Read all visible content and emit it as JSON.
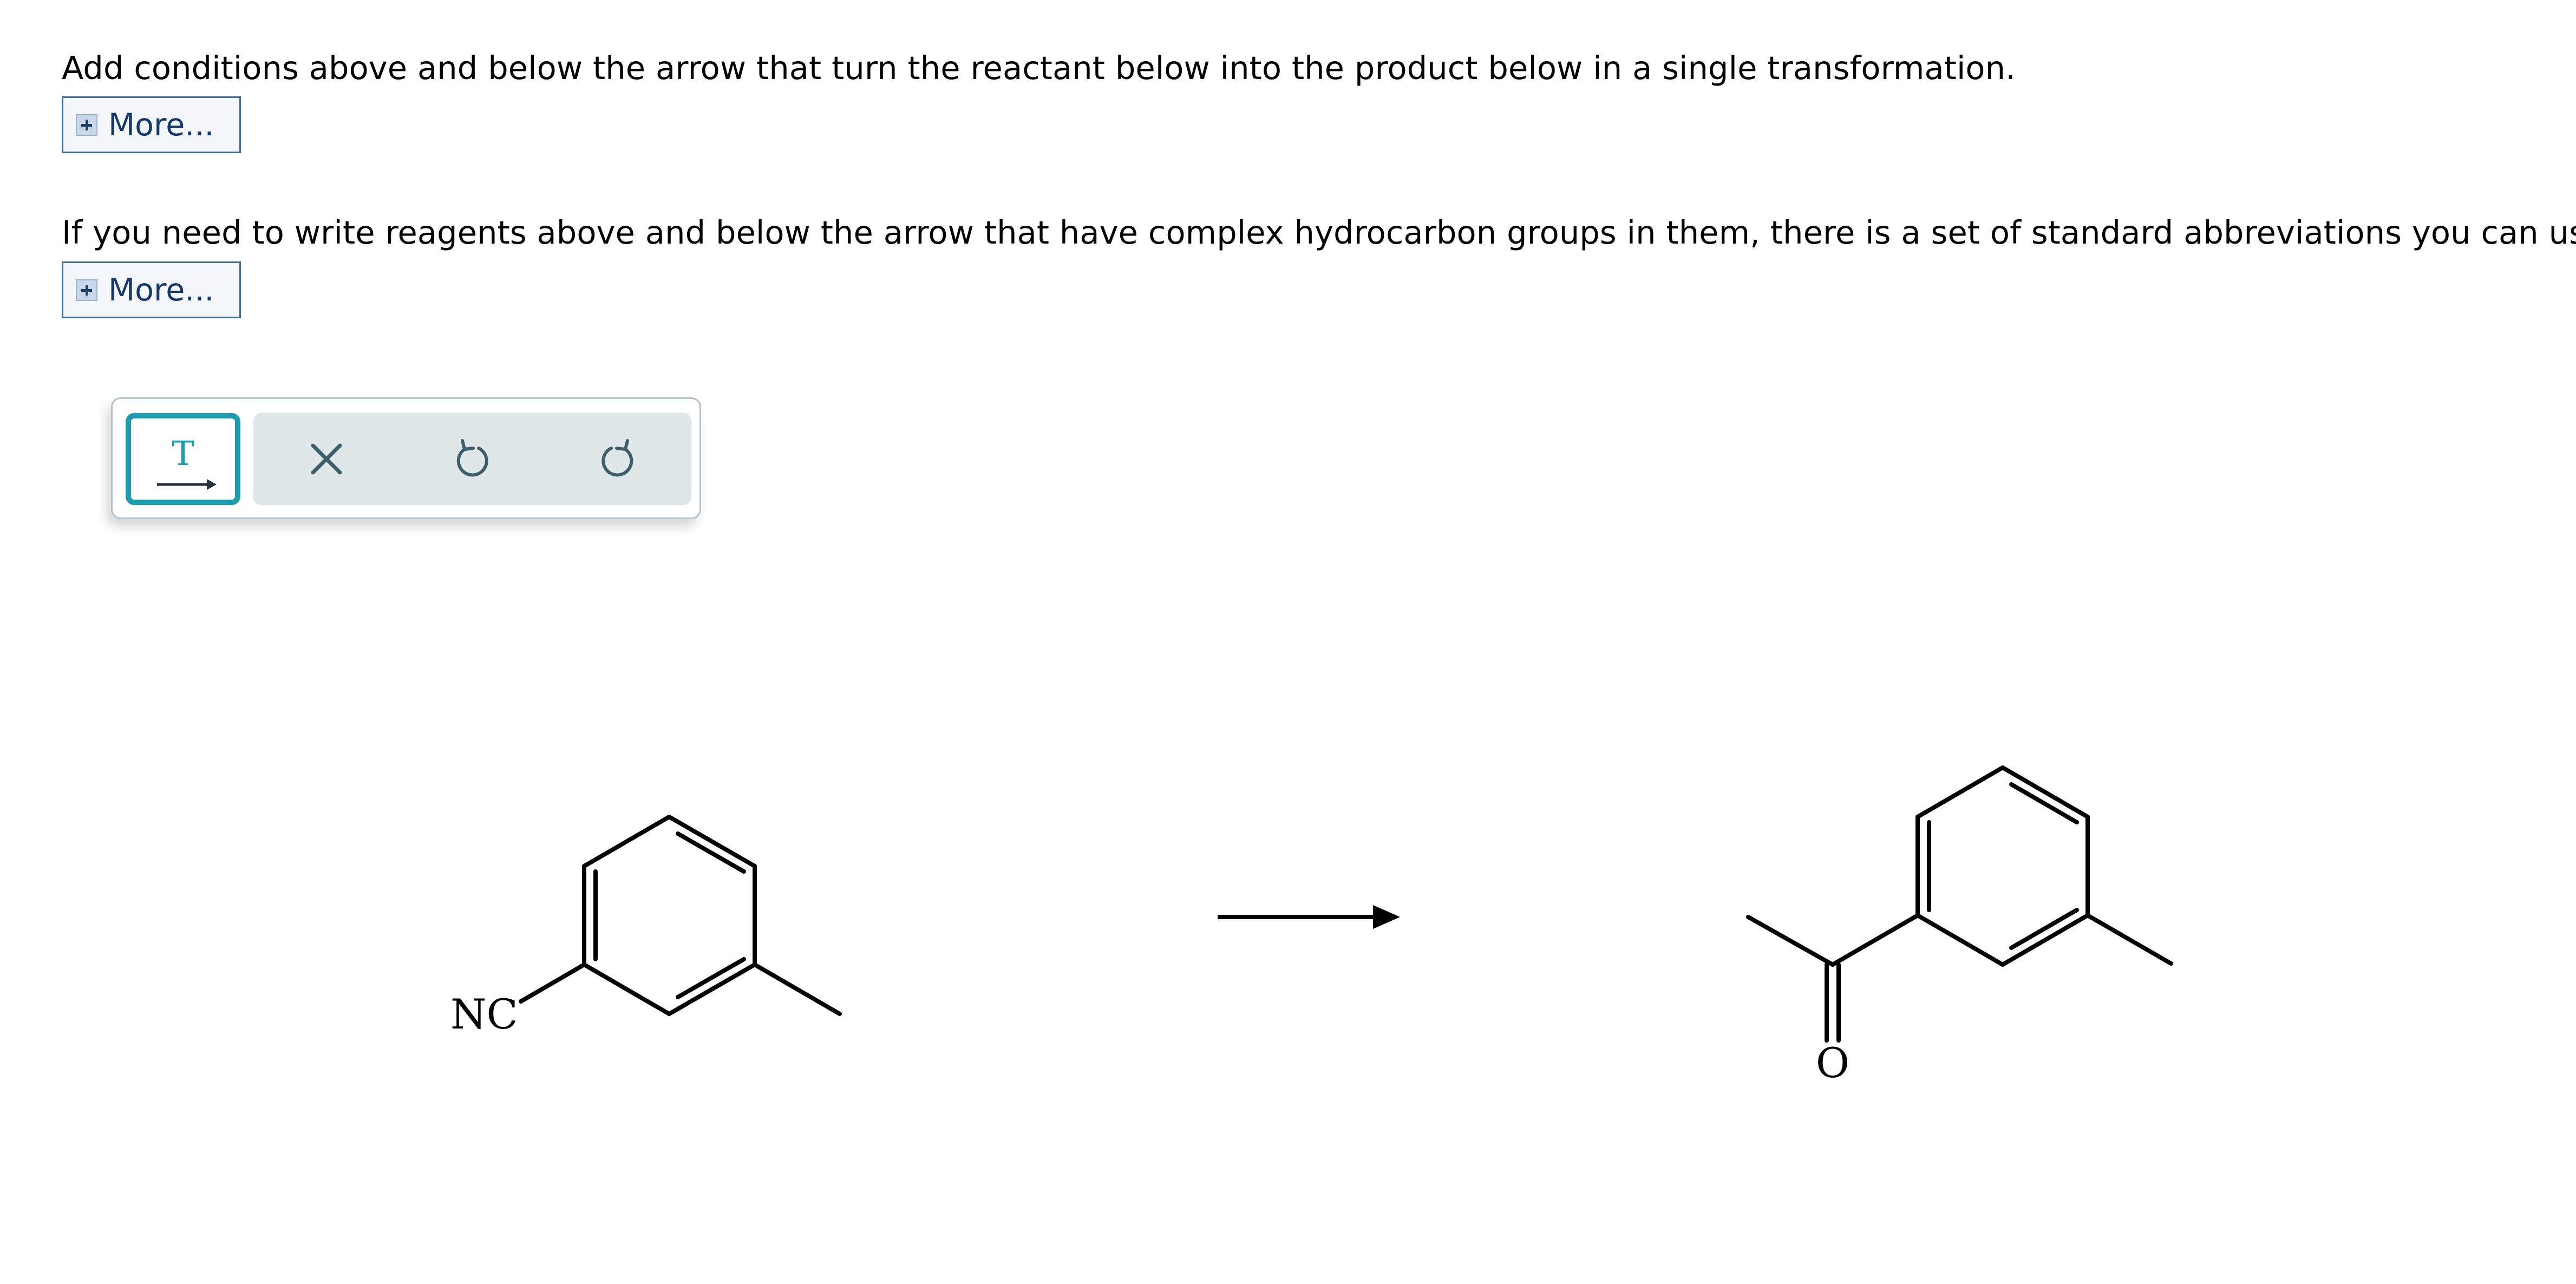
{
  "instructions": {
    "line1": "Add conditions above and below the arrow that turn the reactant below into the product below in a single transformation.",
    "more1": "More...",
    "line2": "If you need to write reagents above and below the arrow that have complex hydrocarbon groups in them, there is a set of standard abbreviations you can use.",
    "more2": "More..."
  },
  "toolbar": {
    "arrow_tool_icon": "text-arrow-icon",
    "arrow_tool_glyph": "T",
    "clear_icon": "close-icon",
    "undo_icon": "undo-icon",
    "redo_icon": "redo-icon",
    "accent_color": "#1f9bb0",
    "icon_color": "#3d5f6b"
  },
  "reaction": {
    "reactant": {
      "substituent_label": "NC"
    },
    "product": {
      "oxygen_label": "O"
    }
  }
}
